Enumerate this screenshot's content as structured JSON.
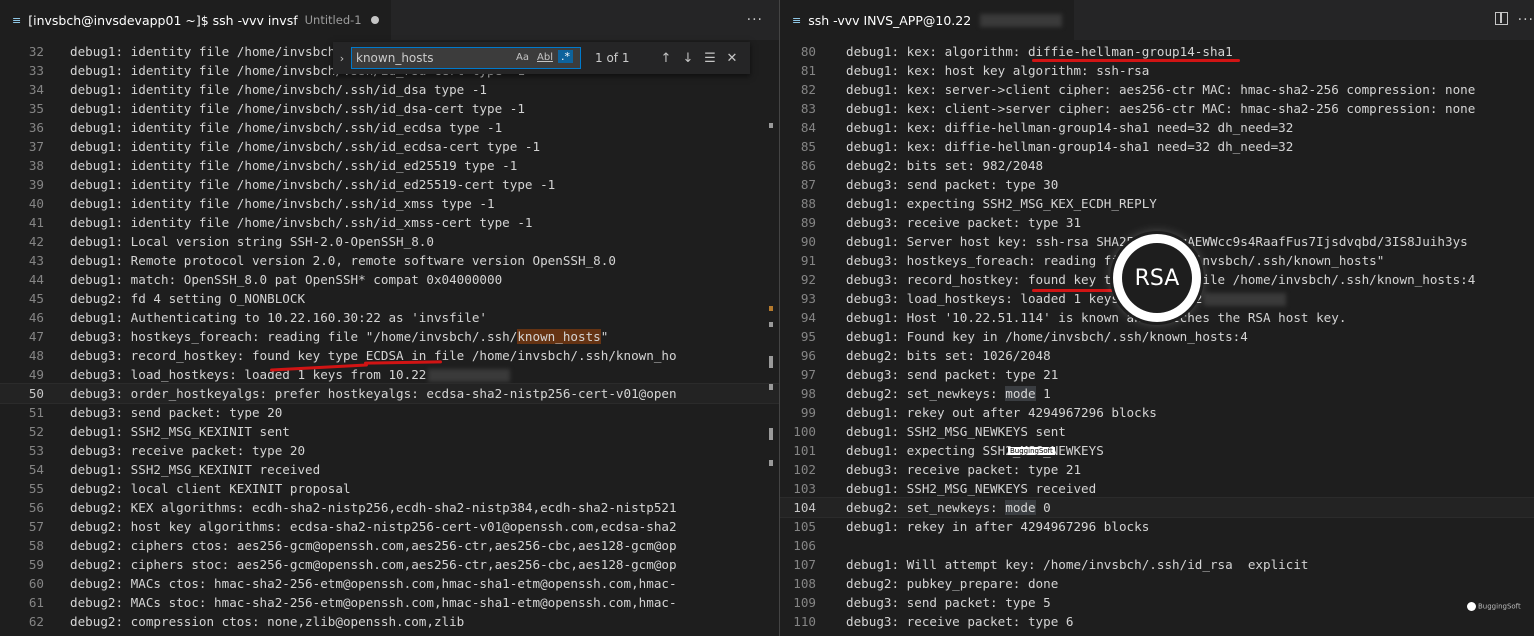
{
  "left": {
    "tab": {
      "title": "[invsbch@invsdevapp01 ~]$ ssh -vvv invsf",
      "untitled": "Untitled-1",
      "more": "···"
    },
    "find": {
      "query": "known_hosts",
      "match_case": "Aa",
      "whole_word": "Abl",
      "regex": ".*",
      "count": "1 of 1",
      "prev": "↑",
      "next": "↓",
      "in_selection": "☰",
      "close": "✕",
      "toggle_replace": "›"
    },
    "lines": [
      {
        "n": "32",
        "t": "debug1: identity file /home/invsbch/.ssh/id_rsa-cert type -1"
      },
      {
        "n": "33",
        "t": "debug1: identity file /home/invsbch/.ssh/id_rsa-cert type -1"
      },
      {
        "n": "34",
        "t": "debug1: identity file /home/invsbch/.ssh/id_dsa type -1"
      },
      {
        "n": "35",
        "t": "debug1: identity file /home/invsbch/.ssh/id_dsa-cert type -1"
      },
      {
        "n": "36",
        "t": "debug1: identity file /home/invsbch/.ssh/id_ecdsa type -1"
      },
      {
        "n": "37",
        "t": "debug1: identity file /home/invsbch/.ssh/id_ecdsa-cert type -1"
      },
      {
        "n": "38",
        "t": "debug1: identity file /home/invsbch/.ssh/id_ed25519 type -1"
      },
      {
        "n": "39",
        "t": "debug1: identity file /home/invsbch/.ssh/id_ed25519-cert type -1"
      },
      {
        "n": "40",
        "t": "debug1: identity file /home/invsbch/.ssh/id_xmss type -1"
      },
      {
        "n": "41",
        "t": "debug1: identity file /home/invsbch/.ssh/id_xmss-cert type -1"
      },
      {
        "n": "42",
        "t": "debug1: Local version string SSH-2.0-OpenSSH_8.0"
      },
      {
        "n": "43",
        "t": "debug1: Remote protocol version 2.0, remote software version OpenSSH_8.0"
      },
      {
        "n": "44",
        "t": "debug1: match: OpenSSH_8.0 pat OpenSSH* compat 0x04000000"
      },
      {
        "n": "45",
        "t": "debug2: fd 4 setting O_NONBLOCK"
      },
      {
        "n": "46",
        "t": "debug1: Authenticating to 10.22.160.30:22 as 'invsfile'"
      },
      {
        "n": "47",
        "pre": "debug3: hostkeys_foreach: reading file \"/home/invsbch/.ssh/",
        "hl": "known_hosts",
        "post": "\""
      },
      {
        "n": "48",
        "t": "debug3: record_hostkey: found key type ECDSA in file /home/invsbch/.ssh/known_ho"
      },
      {
        "n": "49",
        "t": "debug3: load_hostkeys: loaded 1 keys from 10.22",
        "blur": true
      },
      {
        "n": "50",
        "t": "debug3: order_hostkeyalgs: prefer hostkeyalgs: ecdsa-sha2-nistp256-cert-v01@open",
        "cur": true
      },
      {
        "n": "51",
        "t": "debug3: send packet: type 20"
      },
      {
        "n": "52",
        "t": "debug1: SSH2_MSG_KEXINIT sent"
      },
      {
        "n": "53",
        "t": "debug3: receive packet: type 20"
      },
      {
        "n": "54",
        "t": "debug1: SSH2_MSG_KEXINIT received"
      },
      {
        "n": "55",
        "t": "debug2: local client KEXINIT proposal"
      },
      {
        "n": "56",
        "t": "debug2: KEX algorithms: ecdh-sha2-nistp256,ecdh-sha2-nistp384,ecdh-sha2-nistp521"
      },
      {
        "n": "57",
        "t": "debug2: host key algorithms: ecdsa-sha2-nistp256-cert-v01@openssh.com,ecdsa-sha2"
      },
      {
        "n": "58",
        "t": "debug2: ciphers ctos: aes256-gcm@openssh.com,aes256-ctr,aes256-cbc,aes128-gcm@op"
      },
      {
        "n": "59",
        "t": "debug2: ciphers stoc: aes256-gcm@openssh.com,aes256-ctr,aes256-cbc,aes128-gcm@op"
      },
      {
        "n": "60",
        "t": "debug2: MACs ctos: hmac-sha2-256-etm@openssh.com,hmac-sha1-etm@openssh.com,hmac-"
      },
      {
        "n": "61",
        "t": "debug2: MACs stoc: hmac-sha2-256-etm@openssh.com,hmac-sha1-etm@openssh.com,hmac-"
      },
      {
        "n": "62",
        "t": "debug2: compression ctos: none,zlib@openssh.com,zlib"
      }
    ]
  },
  "right": {
    "tab": {
      "title": "ssh -vvv INVS_APP@10.22",
      "more": "···"
    },
    "lines": [
      {
        "n": "80",
        "t": "debug1: kex: algorithm: diffie-hellman-group14-sha1"
      },
      {
        "n": "81",
        "t": "debug1: kex: host key algorithm: ssh-rsa"
      },
      {
        "n": "82",
        "t": "debug1: kex: server->client cipher: aes256-ctr MAC: hmac-sha2-256 compression: none"
      },
      {
        "n": "83",
        "t": "debug1: kex: client->server cipher: aes256-ctr MAC: hmac-sha2-256 compression: none"
      },
      {
        "n": "84",
        "t": "debug1: kex: diffie-hellman-group14-sha1 need=32 dh_need=32"
      },
      {
        "n": "85",
        "t": "debug1: kex: diffie-hellman-group14-sha1 need=32 dh_need=32"
      },
      {
        "n": "86",
        "t": "debug2: bits set: 982/2048"
      },
      {
        "n": "87",
        "t": "debug3: send packet: type 30"
      },
      {
        "n": "88",
        "t": "debug1: expecting SSH2_MSG_KEX_ECDH_REPLY"
      },
      {
        "n": "89",
        "t": "debug3: receive packet: type 31"
      },
      {
        "n": "90",
        "t": "debug1: Server host key: ssh-rsa SHA256:WOTHqAEWWcc9s4RaafFus7Ijsdvqbd/3IS8Juih3ys"
      },
      {
        "n": "91",
        "t": "debug3: hostkeys_foreach: reading file \"/home/invsbch/.ssh/known_hosts\""
      },
      {
        "n": "92",
        "t": "debug3: record_hostkey: found key type RSA in file /home/invsbch/.ssh/known_hosts:4"
      },
      {
        "n": "93",
        "t": "debug3: load_hostkeys: loaded 1 keys from 10.22",
        "blur": true
      },
      {
        "n": "94",
        "t": "debug1: Host '10.22.51.114' is known and matches the RSA host key."
      },
      {
        "n": "95",
        "t": "debug1: Found key in /home/invsbch/.ssh/known_hosts:4"
      },
      {
        "n": "96",
        "t": "debug2: bits set: 1026/2048"
      },
      {
        "n": "97",
        "t": "debug3: send packet: type 21"
      },
      {
        "n": "98",
        "pre": "debug2: set_newkeys: ",
        "hl": "mode",
        "post": " 1"
      },
      {
        "n": "99",
        "t": "debug1: rekey out after 4294967296 blocks"
      },
      {
        "n": "100",
        "t": "debug1: SSH2_MSG_NEWKEYS sent"
      },
      {
        "n": "101",
        "t": "debug1: expecting SSH2_MSG_NEWKEYS"
      },
      {
        "n": "102",
        "t": "debug3: receive packet: type 21"
      },
      {
        "n": "103",
        "t": "debug1: SSH2_MSG_NEWKEYS received"
      },
      {
        "n": "104",
        "pre": "debug2: set_newkeys: ",
        "hl": "mode",
        "post": " 0",
        "cur": true
      },
      {
        "n": "105",
        "t": "debug1: rekey in after 4294967296 blocks"
      },
      {
        "n": "106",
        "t": ""
      },
      {
        "n": "107",
        "t": "debug1: Will attempt key: /home/invsbch/.ssh/id_rsa  explicit"
      },
      {
        "n": "108",
        "t": "debug2: pubkey_prepare: done"
      },
      {
        "n": "109",
        "t": "debug3: send packet: type 5"
      },
      {
        "n": "110",
        "t": "debug3: receive packet: type 6"
      }
    ]
  },
  "overlay": {
    "magnified_label": "RSA",
    "watermark": "BuggingSoft"
  },
  "colors": {
    "background": "#1e1e1e",
    "annotation": "#d11414",
    "find_highlight": "#ea5c00",
    "accent": "#007acc"
  }
}
